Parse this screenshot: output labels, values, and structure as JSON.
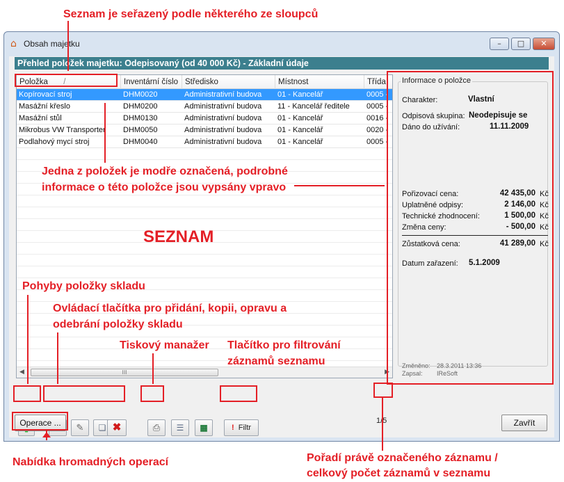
{
  "annotations": {
    "sorted": "Seznam je seřazený podle některého ze sloupců",
    "selected_line1": "Jedna z položek je modře označená, podrobné",
    "selected_line2": "informace o této položce jsou vypsány vpravo",
    "list_label": "SEZNAM",
    "movements": "Pohyby položky skladu",
    "controls_line1": "Ovládací tlačítka pro přidání, kopii, opravu a",
    "controls_line2": "odebrání položky skladu",
    "print_manager": "Tiskový manažer",
    "filter_line1": "Tlačítko pro filtrování",
    "filter_line2": "záznamů seznamu",
    "bulk_ops": "Nabídka hromadných operací",
    "position_line1": "Pořadí právě označeného záznamu /",
    "position_line2": "celkový počet záznamů v seznamu"
  },
  "window": {
    "title": "Obsah majetku",
    "header": "Přehled položek majetku: Odepisovaný (od 40 000 Kč) - Základní údaje"
  },
  "columns": [
    "Položka",
    "Inventární číslo",
    "Středisko",
    "Místnost",
    "Třída"
  ],
  "sort_indicator": "/",
  "rows": [
    {
      "name": "Kopírovací stroj",
      "inv": "DHM0020",
      "center": "Administrativní budova",
      "room": "01 - Kancelář",
      "cls": "0005 -"
    },
    {
      "name": "Masážní křeslo",
      "inv": "DHM0200",
      "center": "Administrativní budova",
      "room": "11 - Kancelář ředitele",
      "cls": "0005 -"
    },
    {
      "name": "Masážní stůl",
      "inv": "DHM0130",
      "center": "Administrativní budova",
      "room": "01 - Kancelář",
      "cls": "0016 -"
    },
    {
      "name": "Mikrobus VW Transporter",
      "inv": "DHM0050",
      "center": "Administrativní budova",
      "room": "01 - Kancelář",
      "cls": "0020 -"
    },
    {
      "name": "Podlahový mycí stroj",
      "inv": "DHM0040",
      "center": "Administrativní budova",
      "room": "01 - Kancelář",
      "cls": "0005 -"
    }
  ],
  "info": {
    "title": "Informace o položce",
    "character_label": "Charakter:",
    "character_value": "Vlastní",
    "group_label": "Odpisová skupina:",
    "group_value": "Neodepisuje se",
    "use_label": "Dáno do užívání:",
    "use_value": "11.11.2009",
    "acq_label": "Pořizovací cena:",
    "acq_value": "42 435,00",
    "dep_label": "Uplatněné odpisy:",
    "dep_value": "2 146,00",
    "tech_label": "Technické zhodnocení:",
    "tech_value": "1 500,00",
    "change_label": "Změna ceny:",
    "change_value": "-  500,00",
    "residual_label": "Zůstatková cena:",
    "residual_value": "41 289,00",
    "currency": "Kč",
    "date_label": "Datum zařazení:",
    "date_value": "5.1.2009",
    "modified_label": "Změněno:",
    "modified_value": "28.3.2011 13:36",
    "written_label": "Zapsal:",
    "written_value": "IReSoft"
  },
  "toolbar": {
    "filter_label": "Filtr",
    "filter_mark": "!",
    "counter": "1/5",
    "scroll_grip": "III"
  },
  "buttons": {
    "operations": "Operace ...",
    "close": "Zavřít"
  },
  "colors": {
    "annotation": "#e41f26",
    "header_bar": "#3c7f8e",
    "selection": "#3399ff"
  }
}
